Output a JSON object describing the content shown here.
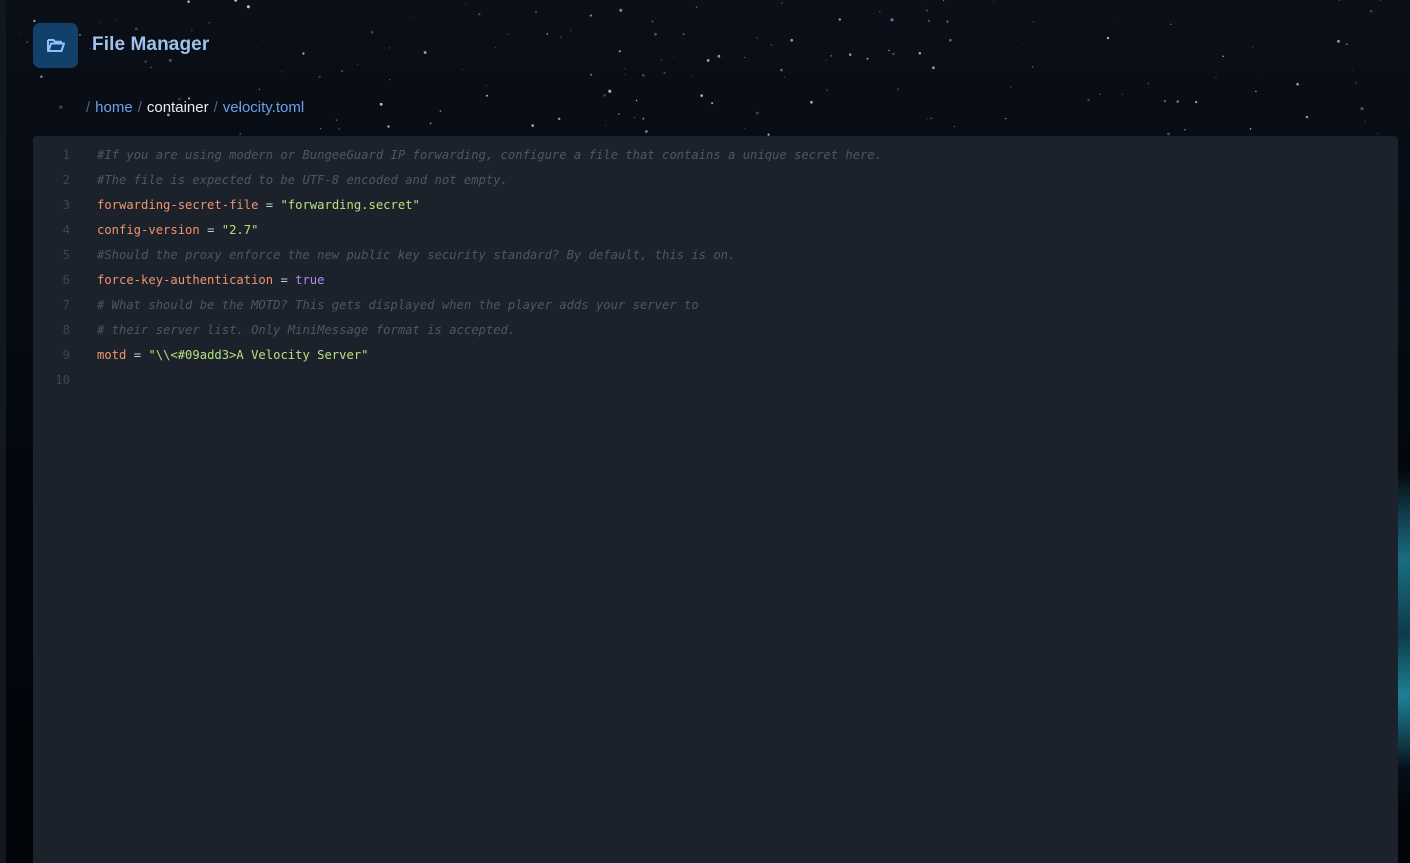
{
  "header": {
    "app_icon": "folder-open-icon",
    "title": "File Manager"
  },
  "breadcrumb": {
    "separator": "/",
    "segments": [
      {
        "label": "home",
        "type": "link"
      },
      {
        "label": "container",
        "type": "current"
      },
      {
        "label": "velocity.toml",
        "type": "file"
      }
    ]
  },
  "editor": {
    "language": "toml",
    "lines": [
      {
        "number": "1",
        "tokens": [
          {
            "t": "comment",
            "v": "#If you are using modern or BungeeGuard IP forwarding, configure a file that contains a unique secret here."
          }
        ]
      },
      {
        "number": "2",
        "tokens": [
          {
            "t": "comment",
            "v": "#The file is expected to be UTF-8 encoded and not empty."
          }
        ]
      },
      {
        "number": "3",
        "tokens": [
          {
            "t": "key",
            "v": "forwarding-secret-file"
          },
          {
            "t": "op",
            "v": " = "
          },
          {
            "t": "str",
            "v": "\"forwarding.secret\""
          }
        ]
      },
      {
        "number": "4",
        "tokens": [
          {
            "t": "key",
            "v": "config-version"
          },
          {
            "t": "op",
            "v": " = "
          },
          {
            "t": "str",
            "v": "\"2.7\""
          }
        ]
      },
      {
        "number": "5",
        "tokens": [
          {
            "t": "comment",
            "v": "#Should the proxy enforce the new public key security standard? By default, this is on."
          }
        ]
      },
      {
        "number": "6",
        "tokens": [
          {
            "t": "key",
            "v": "force-key-authentication"
          },
          {
            "t": "op",
            "v": " = "
          },
          {
            "t": "bool",
            "v": "true"
          }
        ]
      },
      {
        "number": "7",
        "tokens": [
          {
            "t": "comment",
            "v": "# What should be the MOTD? This gets displayed when the player adds your server to"
          }
        ]
      },
      {
        "number": "8",
        "tokens": [
          {
            "t": "comment",
            "v": "# their server list. Only MiniMessage format is accepted."
          }
        ]
      },
      {
        "number": "9",
        "tokens": [
          {
            "t": "key",
            "v": "motd"
          },
          {
            "t": "op",
            "v": " = "
          },
          {
            "t": "str",
            "v": "\"\\\\<#09add3>A Velocity Server\""
          }
        ]
      },
      {
        "number": "10",
        "tokens": []
      }
    ]
  },
  "colors": {
    "accent": "#6ea0e6",
    "editor_bg": "#1c222c",
    "comment": "#4c5666",
    "key": "#f0946a",
    "string": "#b8e07a",
    "boolean": "#b487ef"
  }
}
